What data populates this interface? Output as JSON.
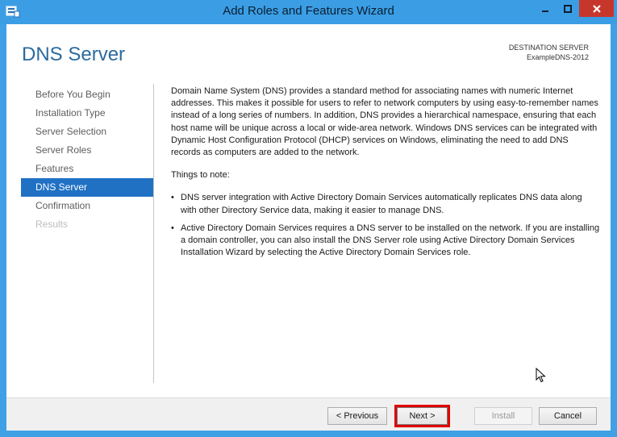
{
  "window": {
    "title": "Add Roles and Features Wizard"
  },
  "header": {
    "page_title": "DNS Server",
    "destination_label": "DESTINATION SERVER",
    "destination_server": "ExampleDNS-2012"
  },
  "nav": {
    "items": [
      {
        "label": "Before You Begin",
        "state": "normal"
      },
      {
        "label": "Installation Type",
        "state": "normal"
      },
      {
        "label": "Server Selection",
        "state": "normal"
      },
      {
        "label": "Server Roles",
        "state": "normal"
      },
      {
        "label": "Features",
        "state": "normal"
      },
      {
        "label": "DNS Server",
        "state": "active"
      },
      {
        "label": "Confirmation",
        "state": "normal"
      },
      {
        "label": "Results",
        "state": "disabled"
      }
    ]
  },
  "content": {
    "intro": "Domain Name System (DNS) provides a standard method for associating names with numeric Internet addresses. This makes it possible for users to refer to network computers by using easy-to-remember names instead of a long series of numbers. In addition, DNS provides a hierarchical namespace, ensuring that each host name will be unique across a local or wide-area network. Windows DNS services can be integrated with Dynamic Host Configuration Protocol (DHCP) services on Windows, eliminating the need to add DNS records as computers are added to the network.",
    "things_heading": "Things to note:",
    "bullets": [
      "DNS server integration with Active Directory Domain Services automatically replicates DNS data along with other Directory Service data, making it easier to manage DNS.",
      "Active Directory Domain Services requires a DNS server to be installed on the network. If you are installing a domain controller, you can also install the DNS Server role using Active Directory Domain Services Installation Wizard by selecting the Active Directory Domain Services role."
    ],
    "bullet_glyph": "•"
  },
  "footer": {
    "previous_label": "< Previous",
    "next_label": "Next >",
    "install_label": "Install",
    "cancel_label": "Cancel"
  },
  "titlebar_buttons": {
    "minimize_glyph": "▁",
    "maximize_glyph": "◻",
    "close_glyph": "✕"
  },
  "colors": {
    "accent": "#2071c4",
    "title_blue": "#2b6a9e",
    "highlight_border": "#e00000"
  }
}
